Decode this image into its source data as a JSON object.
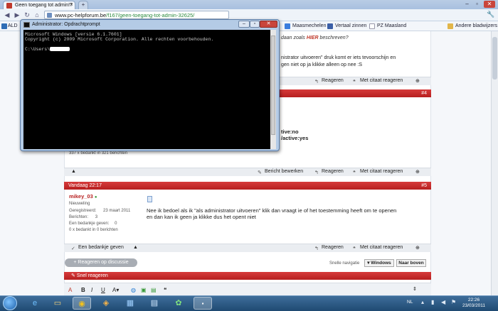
{
  "browser": {
    "tab_title": "Geen toegang tot admin!?",
    "tab_close": "x",
    "new_tab": "+",
    "url_host": "www.pc-helpforum.be",
    "url_path": "/f167/geen-toegang-tot-admin-32625/",
    "wrench": "🔧",
    "bookmarks_left": "ALD",
    "bookmarks": [
      "Maasmechelen",
      "Vertaal zinnen",
      "PZ Maasland"
    ],
    "other_bookmarks": "Andere bladwijzers",
    "bookmark_colors": [
      "#2f6db5",
      "#3b7ddd",
      "#3b5fa7",
      "#e2b64a"
    ]
  },
  "cmd": {
    "title": "Administrator: Opdrachtprompt",
    "line1": "Microsoft Windows [versie 6.1.7601]",
    "line2": "Copyright (c) 2009 Microsoft Corporation. Alle rechten voorbehouden.",
    "prompt": "C:\\Users\\"
  },
  "post_top": {
    "quote_tail": "daan zoals",
    "quote_link": "HIER",
    "quote_end": "beschreven?",
    "text_1": "nistrator uitvoeren\" druk komt er iets tevoorschijn en",
    "text_2": "gen niet op ja klikke alleen op nee :S",
    "reply": "Reageren",
    "quote_reply": "Met citaat reageren"
  },
  "post_4": {
    "number": "#4",
    "code_1": "tive:no",
    "code_2": "/active:yes",
    "thanks_summary": "337 x bedankt in 321 berichten",
    "edit": "Bericht bewerken",
    "reply": "Reageren",
    "quote_reply": "Met citaat reageren"
  },
  "post_5": {
    "date": "Vandaag 22:17",
    "number": "#5",
    "user": "mikey_03",
    "rank": "Nieuweling",
    "registered_label": "Geregistreerd:",
    "registered_value": "23 maart 2011",
    "posts_label": "Berichten:",
    "posts_value": "3",
    "thanks_given_label": "Een bedankje geven:",
    "thanks_given_value": "0",
    "thanks_received": "0 x bedankt in 0 berichten",
    "message_1": "Nee ik bedoel als ik \"als administrator uitvoeren\" klik dan vraagt ie of het toestemming heeft om te openen",
    "message_2": "en dan kan ik geen ja klikke dus het opent niet",
    "thanks_button": "Een bedankje geven",
    "reply": "Reageren",
    "quote_reply": "Met citaat reageren"
  },
  "footer": {
    "reply_thread": "+ Reageren op discussie",
    "quick_nav": "Snelle navigatie",
    "windows": "▾ Windows",
    "top": "Naar boven",
    "quick_reply": "Snel reageren"
  },
  "editor": {
    "bold": "B",
    "italic": "I",
    "underline": "U"
  },
  "taskbar": {
    "lang": "NL",
    "time": "22:26",
    "date": "23/03/2011"
  }
}
